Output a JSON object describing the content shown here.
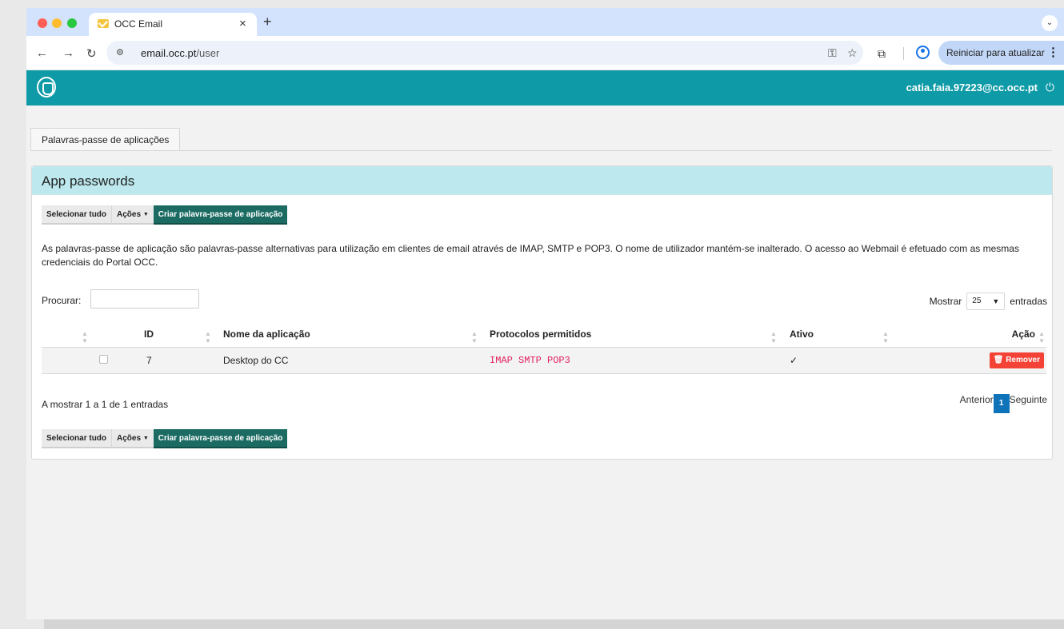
{
  "browser": {
    "tab_title": "OCC Email",
    "tab_close": "×",
    "new_tab": "+",
    "tab_menu": "⌄",
    "url_host": "email.occ.pt",
    "url_path": "/user",
    "restart_label": "Reiniciar para atualizar",
    "icons": [
      "back-icon",
      "forward-icon",
      "reload-icon",
      "site-settings-icon",
      "password-key-icon",
      "bookmark-star-icon",
      "extensions-icon",
      "profile-icon",
      "menu-dots-icon"
    ]
  },
  "header": {
    "user_email": "catia.faia.97223@cc.occ.pt"
  },
  "page_tab": "Palavras-passe de aplicações",
  "panel": {
    "title": "App passwords",
    "select_all": "Selecionar tudo",
    "actions": "Ações",
    "create": "Criar palavra-passe de aplicação",
    "description": "As palavras-passe de aplicação são palavras-passe alternativas para utilização em clientes de email através de IMAP, SMTP e POP3. O nome de utilizador mantém-se inalterado. O acesso ao Webmail é efetuado com as mesmas credenciais do Portal OCC.",
    "search_label": "Procurar:",
    "search_value": "",
    "show_label": "Mostrar",
    "show_value": "25",
    "entries_label": "entradas"
  },
  "table": {
    "columns": [
      "",
      "ID",
      "Nome da aplicação",
      "Protocolos permitidos",
      "Ativo",
      "Ação"
    ],
    "rows": [
      {
        "id": "7",
        "name": "Desktop do CC",
        "protocols": "IMAP SMTP POP3",
        "active": "✓",
        "action": "Remover"
      }
    ]
  },
  "footer": {
    "info": "A mostrar 1 a 1 de 1 entradas",
    "previous": "Anterior",
    "page": "1",
    "next": "Seguinte"
  },
  "colors": {
    "header": "#0e9aa7",
    "panel_head": "#bce8ee",
    "create_button": "#1b6b63",
    "remove_button": "#f44336",
    "protocol_text": "#e0245e",
    "pager_active": "#0e73b8"
  }
}
